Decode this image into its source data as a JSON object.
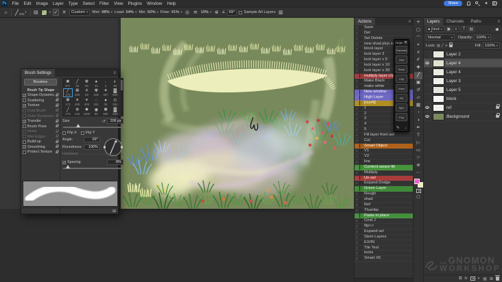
{
  "app": {
    "logo_text": "Ps",
    "share_label": "Share"
  },
  "menubar": {
    "items": [
      "File",
      "Edit",
      "Image",
      "Layer",
      "Type",
      "Select",
      "Filter",
      "View",
      "Plugins",
      "Window",
      "Help"
    ]
  },
  "options_bar": {
    "preset_size": "206",
    "combo": "Custom",
    "wet_label": "Wet:",
    "wet_value": "98%",
    "load_label": "Load:",
    "load_value": "54%",
    "mix_label": "Mix:",
    "mix_value": "50%",
    "flow_label": "Flow:",
    "flow_value": "41%",
    "smoothing_value": "10%",
    "angle_value": "69°",
    "sample_all_layers_label": "Sample All Layers"
  },
  "brush_settings": {
    "title": "Brush Settings",
    "brushes_button": "Brushes",
    "sections": [
      {
        "label": "Brush Tip Shape",
        "header": true
      },
      {
        "label": "Shape Dynamics",
        "checked": true
      },
      {
        "label": "Scattering"
      },
      {
        "label": "Texture",
        "checked": true
      },
      {
        "label": "Dual Brush",
        "dim": true
      },
      {
        "label": "Color Dynamics",
        "dim": true
      },
      {
        "label": "Transfer",
        "checked": true
      },
      {
        "label": "Brush Pose"
      },
      {
        "label": "Noise",
        "dim": true
      },
      {
        "label": "Wet Edges",
        "dim": true
      },
      {
        "label": "Build-up"
      },
      {
        "label": "Smoothing",
        "checked": true
      },
      {
        "label": "Protect Texture"
      }
    ],
    "tips": [
      {
        "g": "✺",
        "n": "677"
      },
      {
        "g": "╱",
        "n": "45"
      },
      {
        "g": "❋",
        "n": "60"
      },
      {
        "g": "●",
        "n": "43"
      },
      {
        "g": "∙",
        "n": "2"
      },
      {
        "g": "◐",
        "n": "60"
      },
      {
        "g": "╱",
        "n": "175",
        "selected": true
      },
      {
        "g": "❆",
        "n": "200"
      },
      {
        "g": "✳",
        "n": "90"
      },
      {
        "g": "✾",
        "n": "525"
      },
      {
        "g": "✦",
        "n": "307"
      },
      {
        "g": "▓",
        "n": "900"
      },
      {
        "g": "❃",
        "n": "173"
      },
      {
        "g": "✶",
        "n": "400"
      },
      {
        "g": "✴",
        "n": "400"
      },
      {
        "g": "◌",
        "n": "261"
      },
      {
        "g": "●",
        "n": "35"
      },
      {
        "g": "⊙",
        "n": "391"
      },
      {
        "g": "╱",
        "n": "175"
      },
      {
        "g": "❉",
        "n": "443"
      },
      {
        "g": "✹",
        "n": "1000"
      },
      {
        "g": "◉",
        "n": "80"
      },
      {
        "g": "✽",
        "n": "590"
      },
      {
        "g": "▓",
        "n": "560"
      }
    ],
    "size_label": "Size",
    "size_value": "206 px",
    "flip_x_label": "Flip X",
    "flip_y_label": "Flip Y",
    "angle_label": "Angle:",
    "angle_value": "69°",
    "roundness_label": "Roundness:",
    "roundness_value": "100%",
    "hardness_label": "Hardness",
    "spacing_label": "Spacing",
    "spacing_value": "8%"
  },
  "actions_panel": {
    "title": "Actions",
    "items": [
      {
        "label": "Save"
      },
      {
        "label": "Del"
      },
      {
        "label": "Sel Delete"
      },
      {
        "label": "new shad plus set pen"
      },
      {
        "label": "block layer"
      },
      {
        "label": "lock layer 3"
      },
      {
        "label": "lock layer x 5"
      },
      {
        "label": "lock layer x 10"
      },
      {
        "label": "lock layer x 30"
      },
      {
        "label": "multiply layer clip",
        "bg": "#a03a3a"
      },
      {
        "label": "Make Black"
      },
      {
        "label": "make white"
      },
      {
        "label": "New window",
        "bg": "#6b64c1"
      },
      {
        "label": "High Layer",
        "bg": "#7069c4"
      },
      {
        "label": "[nuvfil]",
        "bg": "#b08f22"
      },
      {
        "label": "1"
      },
      {
        "label": "2"
      },
      {
        "label": "3"
      },
      {
        "label": "4"
      },
      {
        "label": "5"
      },
      {
        "label": "Fill layer from sel"
      },
      {
        "label": "Col"
      },
      {
        "label": "Smart Object",
        "bg": "#b06119"
      },
      {
        "label": "V1"
      },
      {
        "label": "V2"
      },
      {
        "label": "line"
      },
      {
        "label": "Content aware fill",
        "bg": "#46933c"
      },
      {
        "label": "Multiply"
      },
      {
        "label": "Un-sel",
        "bg": "#aa3b3b"
      },
      {
        "label": "Expand Dodge"
      },
      {
        "label": "Green Layer",
        "bg": "#3f8937"
      },
      {
        "label": "Rough"
      },
      {
        "label": "shad"
      },
      {
        "label": "Ref"
      },
      {
        "label": "Thumbs"
      },
      {
        "label": "Paste in place",
        "bg": "#44903c"
      },
      {
        "label": "Cmd J"
      },
      {
        "label": "flip<>"
      },
      {
        "label": "Expand sel"
      },
      {
        "label": "Stem Layers"
      },
      {
        "label": "EX/IN"
      },
      {
        "label": "Tile Test"
      },
      {
        "label": "locks"
      },
      {
        "label": "Smart X5"
      }
    ]
  },
  "macro_pad": {
    "title": "Hope",
    "close": "✕",
    "buttons": [
      "Translate",
      "Hist",
      "Redo",
      "Clip",
      "Inset",
      "Fill",
      "Spin",
      "Pop"
    ],
    "pencil": "✎",
    "arrow": "↓"
  },
  "tools": {
    "items": [
      {
        "name": "move-tool",
        "g": "✛"
      },
      {
        "name": "marquee-tool",
        "g": "▢"
      },
      {
        "name": "lasso-tool",
        "g": "◠"
      },
      {
        "name": "object-selection-tool",
        "g": "⌖"
      },
      {
        "name": "crop-tool",
        "g": "#"
      },
      {
        "name": "eyedropper-tool",
        "g": "✐"
      },
      {
        "name": "healing-brush-tool",
        "g": "✚"
      },
      {
        "name": "mixer-brush-tool",
        "g": "╱",
        "selected": true
      },
      {
        "name": "clone-stamp-tool",
        "g": "▣"
      },
      {
        "name": "history-brush-tool",
        "g": "↺"
      },
      {
        "name": "eraser-tool",
        "g": "▱"
      },
      {
        "name": "gradient-tool",
        "g": "▦"
      },
      {
        "name": "blur-tool",
        "g": "◔"
      },
      {
        "name": "dodge-tool",
        "g": "◑"
      },
      {
        "name": "pen-tool",
        "g": "✒"
      },
      {
        "name": "type-tool",
        "g": "T"
      },
      {
        "name": "path-selection-tool",
        "g": "▷"
      },
      {
        "name": "shape-tool",
        "g": "▭"
      },
      {
        "name": "hand-tool",
        "g": "☞"
      },
      {
        "name": "zoom-tool",
        "g": "⊕"
      },
      {
        "name": "edit-toolbar-button",
        "g": "⋯"
      }
    ],
    "foreground_color": "#ee5ec6",
    "background_color": "#f2eeb0"
  },
  "layers_panel": {
    "tabs": [
      "Layers",
      "Channels",
      "Paths"
    ],
    "filter_label": "Kind",
    "blend_mode": "Normal",
    "opacity_label": "Opacity:",
    "opacity_value": "100%",
    "lock_label": "Lock:",
    "fill_label": "Fill:",
    "fill_value": "100%",
    "fx_label": "fx",
    "layers": [
      {
        "name": "Layer 2",
        "thumb": "#e8e8df"
      },
      {
        "name": "Layer 4",
        "eye": true,
        "selected": true,
        "thumb": "#dfe4cf"
      },
      {
        "name": "Layer 4",
        "thumb": "#ecece2"
      },
      {
        "name": "Layer 3",
        "thumb": "#f0f0ea"
      },
      {
        "name": "Layer 5",
        "thumb": "#e6e6e0"
      },
      {
        "name": "block",
        "thumb": "#f7f7f7"
      },
      {
        "name": "ref",
        "eye": true,
        "locked": true,
        "thumb": "#f0f0ee"
      },
      {
        "name": "Background",
        "eye": true,
        "locked": true,
        "italic": true,
        "thumb": "#7b8a5e"
      }
    ]
  },
  "watermark": {
    "the": "THE",
    "name": "GNOMON",
    "sub": "WORKSHOP"
  }
}
